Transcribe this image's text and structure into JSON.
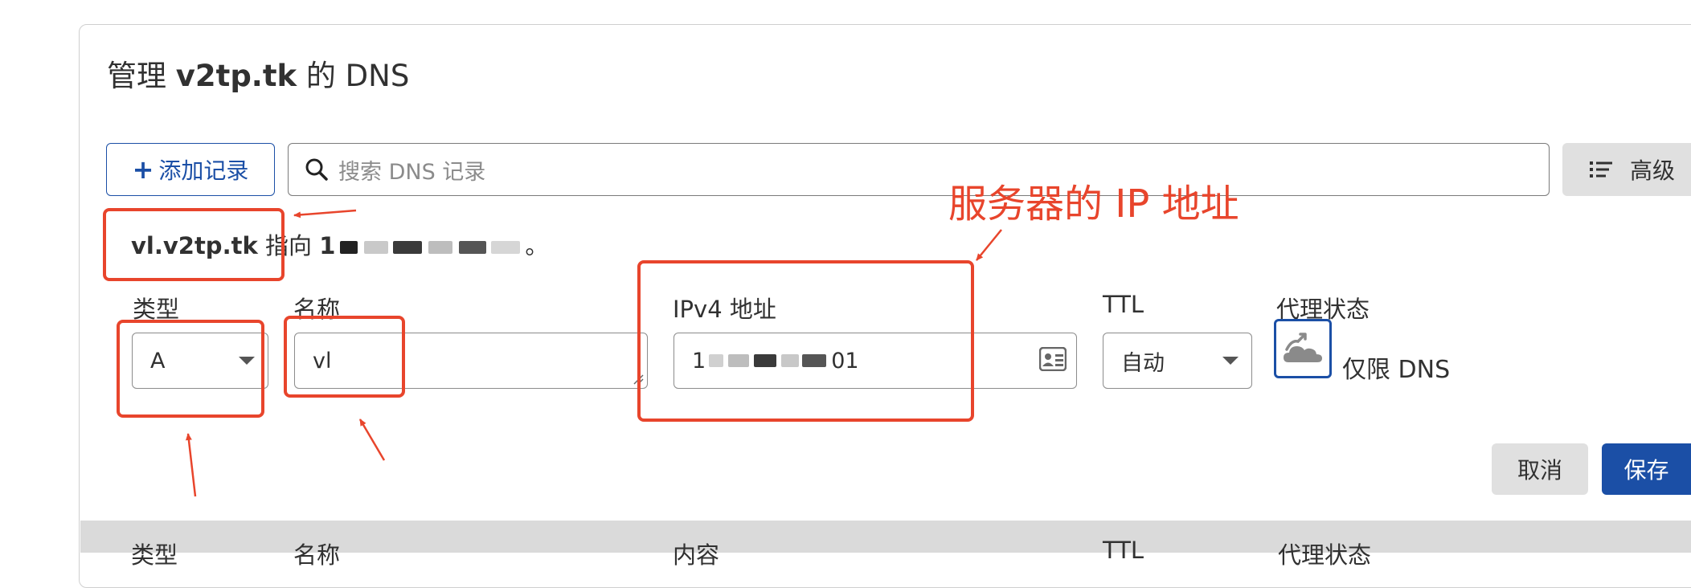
{
  "dialog": {
    "title_prefix": "管理",
    "domain": "v2tp.tk",
    "title_suffix": "的 DNS"
  },
  "toolbar": {
    "add_record_icon": "+",
    "add_record_label": "添加记录",
    "search_placeholder": "搜索 DNS 记录",
    "advanced_label": "高级"
  },
  "record_preview": {
    "hostname": "vl.v2tp.tk",
    "points_to": "指向",
    "ip_visible_start": "1",
    "ip_end_char": "。"
  },
  "form": {
    "type_label": "类型",
    "type_value": "A",
    "name_label": "名称",
    "name_value": "vl",
    "ipv4_label": "IPv4 地址",
    "ipv4_visible_start": "1",
    "ipv4_visible_end": "01",
    "ttl_label": "TTL",
    "ttl_value": "自动",
    "proxy_label": "代理状态",
    "proxy_value": "仅限 DNS"
  },
  "actions": {
    "cancel_label": "取消",
    "save_label": "保存"
  },
  "table_header": {
    "col_type": "类型",
    "col_name": "名称",
    "col_content": "内容",
    "col_ttl": "TTL",
    "col_proxy": "代理状态"
  },
  "annotation": {
    "text": "服务器的 IP 地址",
    "color": "#e8452c"
  },
  "colors": {
    "primary": "#1b4fa6",
    "annotation": "#e8452c",
    "table_header_bg": "#dadada",
    "button_grey": "#e0e0e0"
  },
  "icons": [
    "plus-icon",
    "search-icon",
    "list-icon",
    "chevron-down-icon",
    "id-card-icon",
    "cloud-dns-icon"
  ]
}
